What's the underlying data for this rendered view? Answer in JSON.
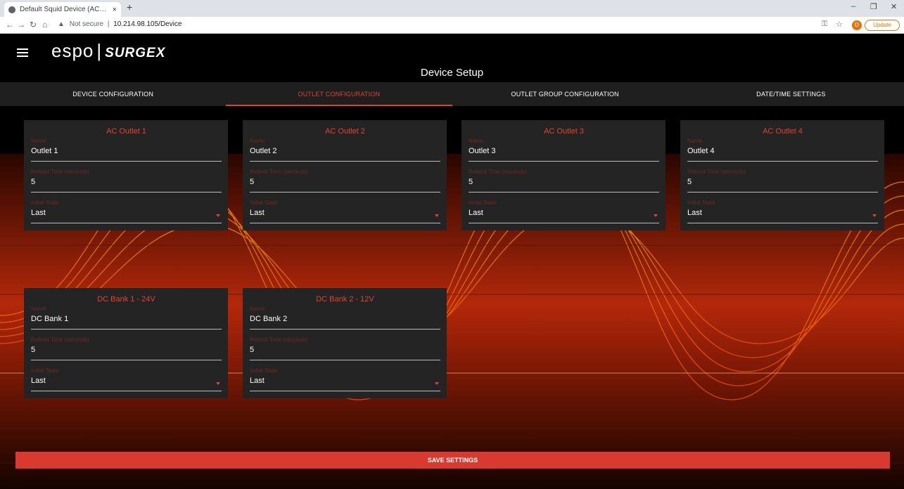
{
  "browser": {
    "tab_title": "Default Squid Device (ACMs672)",
    "tab_close": "×",
    "new_tab": "+",
    "url_warning": "Not secure",
    "url_separator": "|",
    "url_host": "10.214.98.105/Device",
    "profile_initial": "D",
    "update_label": "Update"
  },
  "app": {
    "logo_espo": "espo",
    "logo_sep": "|",
    "logo_surgex": "SURGEX",
    "page_title": "Device Setup",
    "tabs": [
      {
        "label": "DEVICE CONFIGURATION"
      },
      {
        "label": "OUTLET CONFIGURATION"
      },
      {
        "label": "OUTLET GROUP CONFIGURATION"
      },
      {
        "label": "DATE/TIME SETTINGS"
      }
    ],
    "name_label": "Name",
    "reboot_label": "Reboot Time (seconds)",
    "state_label": "Initial State",
    "cards": [
      {
        "title": "AC Outlet 1",
        "name": "Outlet 1",
        "reboot": "5",
        "state": "Last"
      },
      {
        "title": "AC Outlet 2",
        "name": "Outlet 2",
        "reboot": "5",
        "state": "Last"
      },
      {
        "title": "AC Outlet 3",
        "name": "Outlet 3",
        "reboot": "5",
        "state": "Last"
      },
      {
        "title": "AC Outlet 4",
        "name": "Outlet 4",
        "reboot": "5",
        "state": "Last"
      },
      {
        "title": "DC Bank 1 - 24V",
        "name": "DC Bank 1",
        "reboot": "5",
        "state": "Last"
      },
      {
        "title": "DC Bank 2 - 12V",
        "name": "DC Bank 2",
        "reboot": "5",
        "state": "Last"
      }
    ],
    "save_label": "SAVE SETTINGS"
  },
  "colors": {
    "accent": "#e0442f",
    "save_bar": "#d93a2f",
    "card_bg": "#242424",
    "tab_bg": "#1f1f1f"
  }
}
